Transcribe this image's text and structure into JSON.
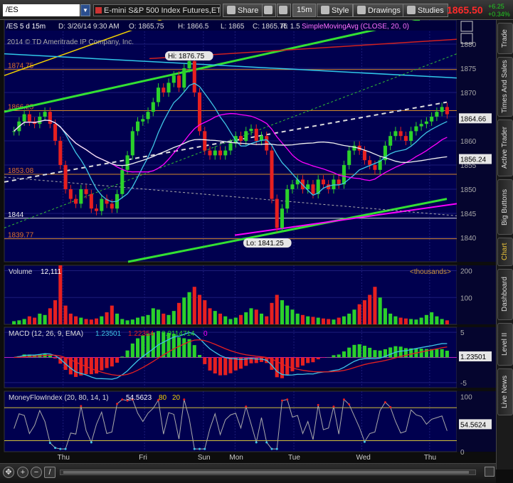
{
  "toolbar": {
    "symbol": "/ES",
    "description": "E-mini S&P 500 Index Futures,ET...",
    "share": "Share",
    "interval": "15m",
    "style": "Style",
    "drawings": "Drawings",
    "studies": "Studies",
    "last_price": "1865.50",
    "change_pts": "+6.25",
    "change_pct": "+0.34%"
  },
  "right_tabs": [
    "Trade",
    "Times And Sales",
    "Active Trader",
    "Big Buttons",
    "Chart",
    "Dashboard",
    "Level II",
    "Live News"
  ],
  "right_tabs_active": "Chart",
  "bottom": {
    "pan": "pan-icon",
    "zoom_in": "zoom-in-icon",
    "zoom_out": "zoom-out-icon",
    "draw": "drawing-tool-icon"
  },
  "colors": {
    "bg": "#00004f",
    "grid": "#1c1c7a",
    "up": "#2bd12b",
    "down": "#e62020",
    "price_label": "#ff2b2b",
    "ma20": "#ff00ff",
    "ma9": "#3fc6e6",
    "ma50": "#f2f2f2",
    "macd_line": "#3fc6e6",
    "signal_line": "#e62020",
    "macd_hist_up": "#2bd12b",
    "macd_hist_down": "#e62020",
    "mfi": "#aaaaaa"
  },
  "chart_data": [
    {
      "panel": "price",
      "type": "candlestick",
      "header": {
        "symbol": "/ES 5 d 15m",
        "date": "D: 3/26/14 9:30 AM",
        "open": "O: 1865.75",
        "high": "H: 1866.5",
        "low": "L: 1865",
        "close": "C: 1865.75",
        "range": "R: 1.5",
        "study": "SimpleMovingAvg (CLOSE, 20, 0)"
      },
      "copyright": "2014 © TD Ameritrade IP Company, Inc.",
      "ylim": [
        1835,
        1885
      ],
      "yticks": [
        1840,
        1845,
        1850,
        1855,
        1860,
        1865,
        1870,
        1875,
        1880
      ],
      "x_day_labels": [
        "Thu",
        "Fri",
        "Sun",
        "Mon",
        "Tue",
        "Wed",
        "Thu"
      ],
      "closes": [
        1862,
        1864,
        1865.5,
        1864,
        1863.5,
        1865,
        1866,
        1863.5,
        1860,
        1855,
        1850,
        1848,
        1847,
        1850,
        1849,
        1846,
        1845.5,
        1848,
        1847,
        1846,
        1849,
        1854,
        1857,
        1862,
        1864,
        1864.5,
        1866,
        1868,
        1871,
        1870,
        1872,
        1873.5,
        1871,
        1875,
        1876.5,
        1870,
        1862,
        1858,
        1857,
        1858,
        1857,
        1858,
        1859.5,
        1861,
        1860,
        1862,
        1862.5,
        1860,
        1861,
        1858,
        1848,
        1842,
        1846,
        1850,
        1851,
        1852,
        1850,
        1851,
        1849,
        1852,
        1851,
        1850,
        1852,
        1851,
        1855,
        1858,
        1859,
        1858,
        1856,
        1855,
        1854,
        1856,
        1859,
        1861,
        1862,
        1861,
        1860,
        1862,
        1863,
        1863.5,
        1864,
        1865,
        1866,
        1867,
        1865.5
      ],
      "price_labels": [
        {
          "text": "1874.75",
          "value": 1874.75
        },
        {
          "text": "1866.25",
          "value": 1866.25
        },
        {
          "text": "1853.08",
          "value": 1853.08
        },
        {
          "text": "1844",
          "value": 1844
        },
        {
          "text": "1839.77",
          "value": 1839.77
        }
      ],
      "hi_label": "Hi: 1876.75",
      "lo_label": "Lo: 1841.25",
      "right_labels": [
        {
          "text": "1864.66",
          "value": 1864.66
        },
        {
          "text": "1856.24",
          "value": 1856.24
        }
      ]
    },
    {
      "panel": "volume",
      "type": "bar",
      "title": "Volume",
      "value": "12,111",
      "unit": "<thousands>",
      "ylim": [
        0,
        220
      ],
      "yticks": [
        100,
        200
      ],
      "values": [
        12,
        15,
        20,
        30,
        25,
        40,
        35,
        60,
        90,
        220,
        70,
        40,
        30,
        25,
        20,
        18,
        22,
        30,
        45,
        70,
        40,
        20,
        15,
        18,
        25,
        30,
        35,
        60,
        55,
        40,
        35,
        50,
        80,
        100,
        120,
        140,
        110,
        90,
        60,
        50,
        40,
        30,
        20,
        25,
        35,
        45,
        60,
        55,
        40,
        30,
        80,
        110,
        90,
        70,
        55,
        40,
        35,
        30,
        28,
        25,
        22,
        20,
        18,
        25,
        30,
        40,
        55,
        75,
        90,
        110,
        140,
        100,
        60,
        40,
        30,
        25,
        22,
        20,
        18,
        25,
        35,
        45,
        30,
        20,
        15
      ]
    },
    {
      "panel": "macd",
      "type": "macd",
      "title": "MACD (12, 26, 9, EMA)",
      "value": "1.23501",
      "avg": "1.22354",
      "diff": "0.0114714",
      "zero": "0",
      "ylim": [
        -6,
        6
      ],
      "yticks": [
        -5,
        0,
        5
      ]
    },
    {
      "panel": "mfi",
      "type": "line",
      "title": "MoneyFlowIndex (20, 80, 14, 1)",
      "value": "54.5623",
      "overbought": "80",
      "oversold": "20",
      "ylim": [
        0,
        110
      ],
      "yticks": [
        0,
        50,
        100
      ],
      "right_label": "54.5624"
    }
  ]
}
